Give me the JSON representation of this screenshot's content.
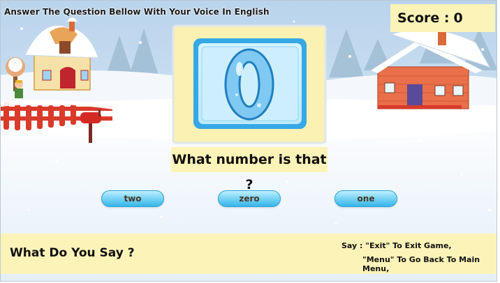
{
  "app": {
    "instruction": "Answer The Question Bellow With Your Voice In English"
  },
  "score": {
    "label": "Score :",
    "value": "0"
  },
  "card": {
    "digit": "0",
    "icon": "number-zero-icon"
  },
  "question": {
    "text": "What number is that ?"
  },
  "answers": [
    {
      "label": "two"
    },
    {
      "label": "zero"
    },
    {
      "label": "one"
    }
  ],
  "footer": {
    "prompt": "What Do You Say ?",
    "help_line1": "Say : \"Exit\" To Exit Game,",
    "help_line2": "\"Menu\" To Go Back To Main Menu,"
  },
  "colors": {
    "panel": "#fcf3b8",
    "button": "#6fd0f4",
    "card_border": "#36a8e6",
    "sky": "#c7dcf0",
    "snow": "#ffffff"
  }
}
